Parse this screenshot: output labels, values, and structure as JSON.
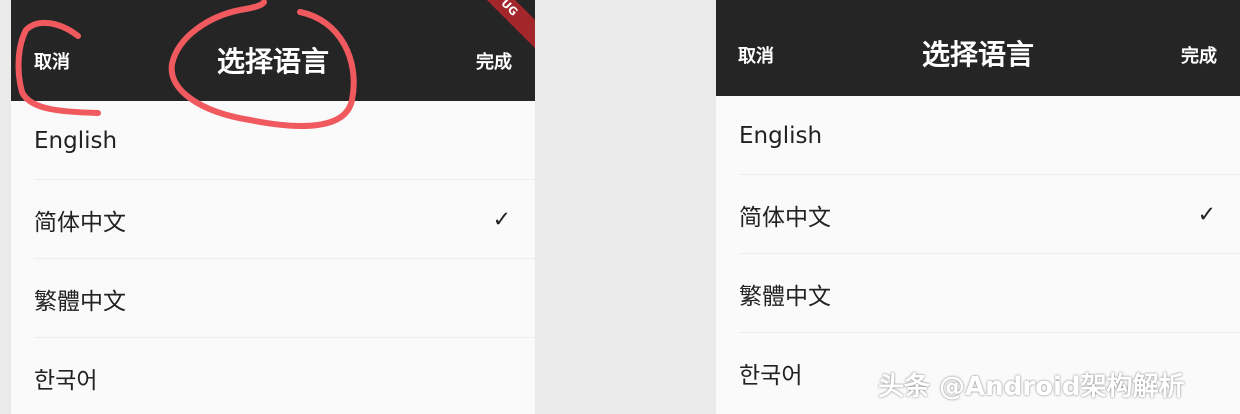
{
  "nav": {
    "cancel_label": "取消",
    "title": "选择语言",
    "done_label": "完成"
  },
  "debug_banner": "UG",
  "languages": [
    {
      "label": "English",
      "selected": false
    },
    {
      "label": "简体中文",
      "selected": true
    },
    {
      "label": "繁體中文",
      "selected": false
    },
    {
      "label": "한국어",
      "selected": false
    }
  ],
  "check_glyph": "✓",
  "watermark": "头条 @Android架构解析",
  "colors": {
    "nav_background": "#252525",
    "list_background": "#fafafa",
    "annotation_stroke": "#f05a5e",
    "debug_ribbon": "#a3272a"
  }
}
